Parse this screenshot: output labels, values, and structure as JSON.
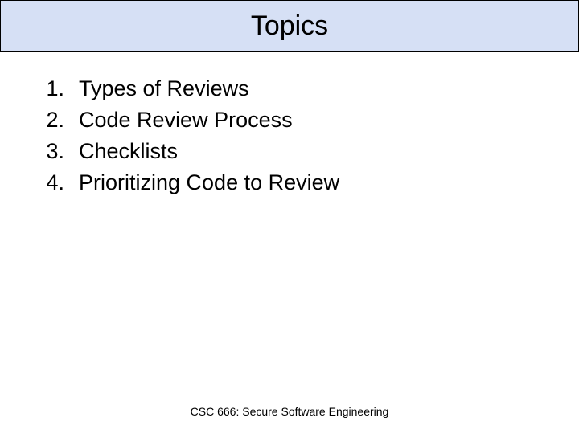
{
  "title": "Topics",
  "items": [
    {
      "number": "1.",
      "text": "Types of Reviews"
    },
    {
      "number": "2.",
      "text": "Code Review Process"
    },
    {
      "number": "3.",
      "text": "Checklists"
    },
    {
      "number": "4.",
      "text": "Prioritizing Code to Review"
    }
  ],
  "footer": "CSC 666: Secure Software Engineering"
}
